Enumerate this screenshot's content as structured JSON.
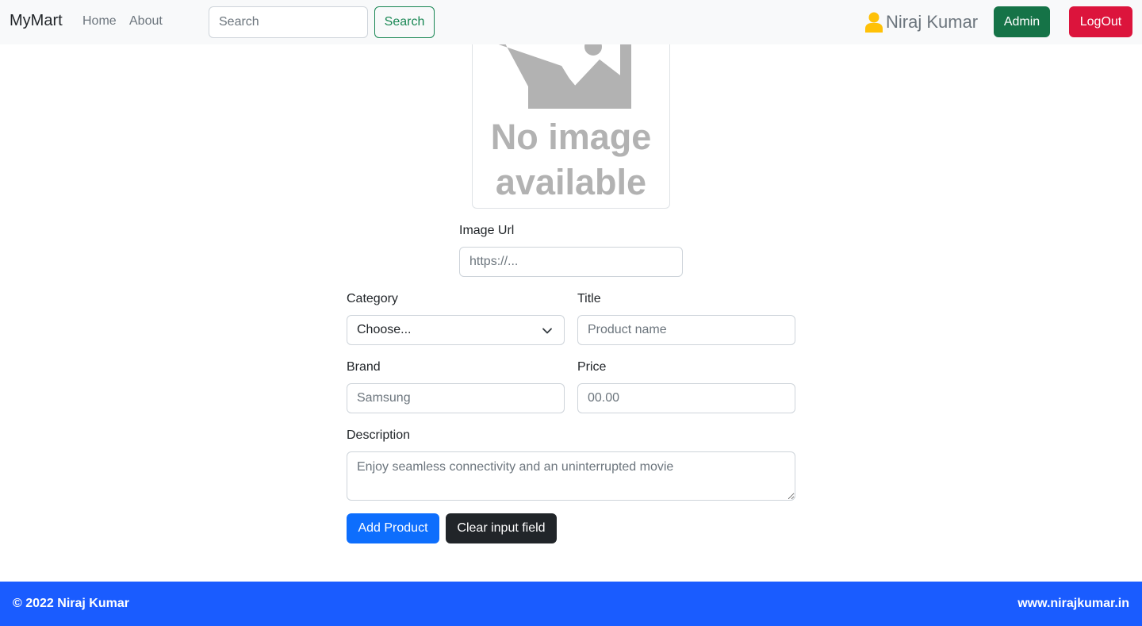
{
  "navbar": {
    "brand": "MyMart",
    "links": [
      "Home",
      "About"
    ],
    "search_placeholder": "Search",
    "search_button": "Search",
    "user_name": "Niraj Kumar",
    "admin_button": "Admin",
    "logout_button": "LogOut",
    "colors": {
      "search_outline": "#198754",
      "admin": "#157347",
      "logout": "#dc143c",
      "user_icon": "#ffc107"
    }
  },
  "preview": {
    "line1": "No image",
    "line2": "available",
    "icon": "image-placeholder-icon"
  },
  "form": {
    "image_url": {
      "label": "Image Url",
      "placeholder": "https://..."
    },
    "category": {
      "label": "Category",
      "selected": "Choose..."
    },
    "title": {
      "label": "Title",
      "placeholder": "Product name"
    },
    "brand": {
      "label": "Brand",
      "placeholder": "Samsung"
    },
    "price": {
      "label": "Price",
      "placeholder": "00.00"
    },
    "description": {
      "label": "Description",
      "placeholder": "Enjoy seamless connectivity and an uninterrupted movie"
    },
    "add_button": "Add Product",
    "clear_button": "Clear input field",
    "colors": {
      "add": "#0d6efd",
      "clear": "#212529"
    }
  },
  "footer": {
    "left": "© 2022 Niraj Kumar",
    "right": "www.nirajkumar.in",
    "color": "#1a5cff"
  }
}
